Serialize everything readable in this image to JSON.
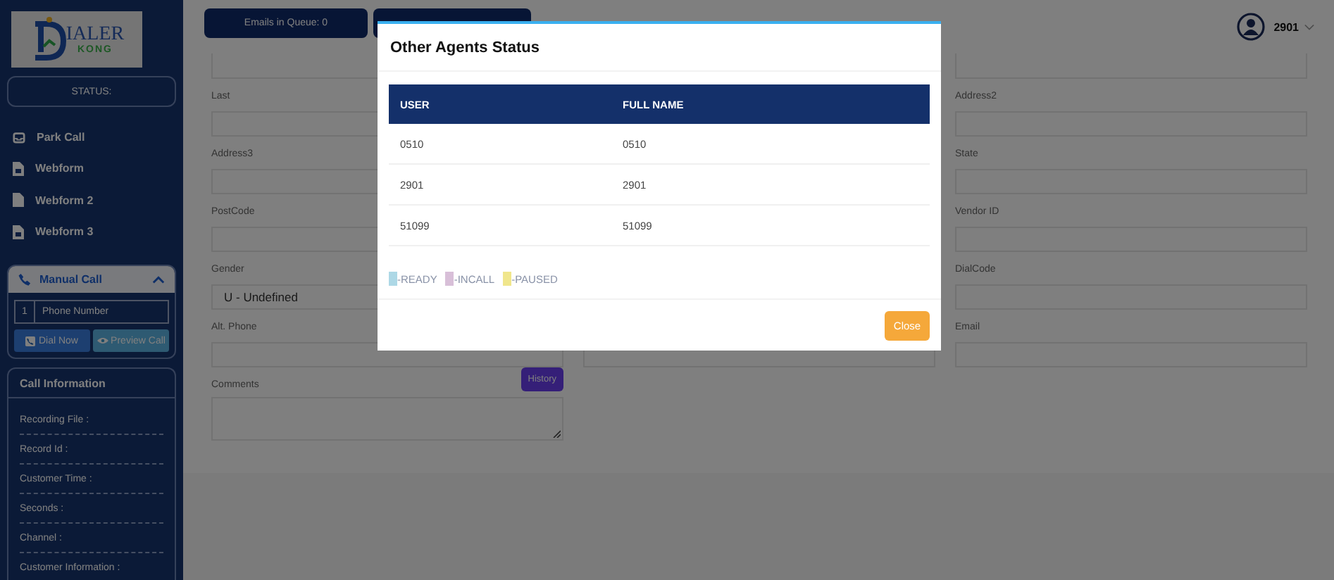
{
  "sidebar": {
    "logo": {
      "wordmark": "IALER",
      "tagline": "KONG"
    },
    "status_label": "STATUS:",
    "menu": [
      {
        "label": "Park Call",
        "kind": "park"
      },
      {
        "label": "Webform",
        "kind": "form"
      },
      {
        "label": "Webform 2",
        "kind": "doc"
      },
      {
        "label": "Webform 3",
        "kind": "form"
      }
    ],
    "manual_call": {
      "title": "Manual Call",
      "expanded": true,
      "country_code": "1",
      "phone_placeholder": "Phone Number",
      "dial_button": "Dial Now",
      "preview_button": "Preview Call"
    },
    "call_information": {
      "title": "Call Information",
      "fields": [
        "Recording File :",
        "Record Id :",
        "Customer Time :",
        "Seconds :",
        "Channel :",
        "Customer Information :"
      ]
    }
  },
  "topbar": {
    "emails_button": "Emails in Queue: 0",
    "user": "2901"
  },
  "form": {
    "columns": [
      [
        {
          "kind": "input"
        },
        {
          "kind": "input",
          "label": "Last"
        },
        {
          "kind": "input",
          "label": "Address3"
        },
        {
          "kind": "input",
          "label": "PostCode"
        },
        {
          "kind": "select",
          "label": "Gender",
          "value": "U - Undefined"
        },
        {
          "kind": "input",
          "label": "Alt. Phone"
        },
        {
          "kind": "textarea",
          "label": "Comments",
          "action": "History"
        }
      ],
      [
        {
          "kind": "input"
        }
      ],
      [
        {
          "kind": "input"
        },
        {
          "kind": "input",
          "label": "Address2"
        },
        {
          "kind": "input",
          "label": "State"
        },
        {
          "kind": "input",
          "label": "Vendor ID"
        },
        {
          "kind": "input",
          "label": "DialCode"
        },
        {
          "kind": "input",
          "label": "Email"
        }
      ]
    ]
  },
  "modal": {
    "title": "Other Agents Status",
    "columns": [
      "USER",
      "FULL NAME"
    ],
    "rows": [
      [
        "0510",
        "0510"
      ],
      [
        "2901",
        "2901"
      ],
      [
        "51099",
        "51099"
      ]
    ],
    "legend": [
      {
        "label": "-READY",
        "color": "#add8e6"
      },
      {
        "label": "-INCALL",
        "color": "#d8bfd8"
      },
      {
        "label": "-PAUSED",
        "color": "#f0e68c"
      }
    ],
    "close_button": "Close"
  }
}
